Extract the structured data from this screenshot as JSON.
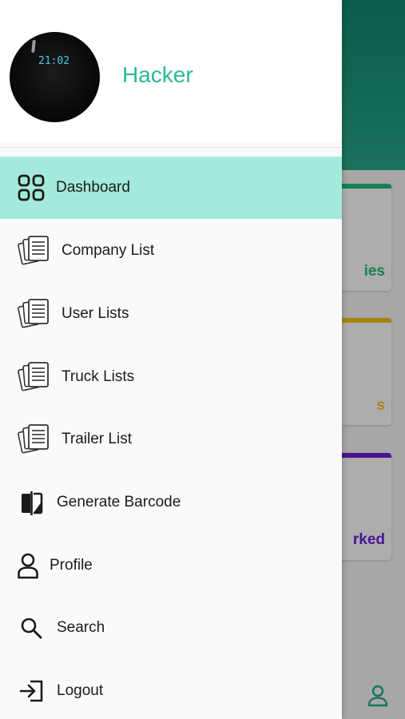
{
  "drawer": {
    "user_name": "Hacker",
    "avatar_clock_text": "21:02",
    "items": [
      {
        "label": "Dashboard",
        "icon": "dashboard-grid-icon",
        "active": true
      },
      {
        "label": "Company List",
        "icon": "document-stack-icon"
      },
      {
        "label": "User Lists",
        "icon": "document-stack-icon"
      },
      {
        "label": "Truck Lists",
        "icon": "document-stack-icon"
      },
      {
        "label": "Trailer List",
        "icon": "document-stack-icon"
      },
      {
        "label": "Generate Barcode",
        "icon": "barcode-compare-icon"
      },
      {
        "label": "Profile",
        "icon": "person-icon"
      },
      {
        "label": "Search",
        "icon": "search-icon"
      },
      {
        "label": "Logout",
        "icon": "logout-icon"
      }
    ]
  },
  "background": {
    "cards": [
      {
        "text": "ies",
        "accent": "#1fbf7a",
        "text_color": "#1fbf7a"
      },
      {
        "text": "s",
        "accent": "#f2c418",
        "text_color": "#f2c418"
      },
      {
        "text": "rked",
        "accent": "#6a1fd6",
        "text_color": "#6a1fd6"
      }
    ],
    "bottom_nav_icon": "person-outline-icon"
  },
  "colors": {
    "accent": "#2bb996",
    "active_item_bg": "#a3eadb",
    "header_gradient_top": "#0f8a6e"
  }
}
